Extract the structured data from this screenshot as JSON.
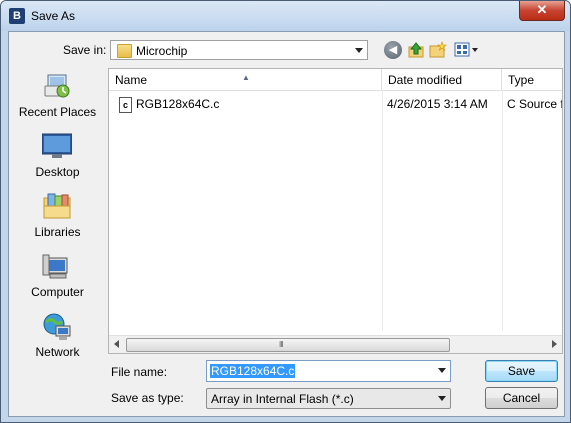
{
  "window": {
    "title": "Save As",
    "app_icon_letter": "B",
    "close_glyph": "✕"
  },
  "toolbar": {
    "save_in_label": "Save in:",
    "location": "Microchip",
    "back_glyph": "◀"
  },
  "places": [
    {
      "label": "Recent Places",
      "icon": "recent-places-icon"
    },
    {
      "label": "Desktop",
      "icon": "desktop-icon"
    },
    {
      "label": "Libraries",
      "icon": "libraries-icon"
    },
    {
      "label": "Computer",
      "icon": "computer-icon"
    },
    {
      "label": "Network",
      "icon": "network-icon"
    }
  ],
  "file_list": {
    "columns": [
      "Name",
      "Date modified",
      "Type"
    ],
    "sort_indicator": "▲",
    "rows": [
      {
        "name": "RGB128x64C.c",
        "date_modified": "4/26/2015 3:14 AM",
        "type": "C Source f",
        "icon_letter": "c"
      }
    ],
    "scrollbar_grip": "III"
  },
  "form": {
    "file_name_label": "File name:",
    "file_name_value": "RGB128x64C.c",
    "save_as_type_label": "Save as type:",
    "save_as_type_value": "Array in Internal Flash (*.c)"
  },
  "buttons": {
    "save": "Save",
    "cancel": "Cancel"
  }
}
